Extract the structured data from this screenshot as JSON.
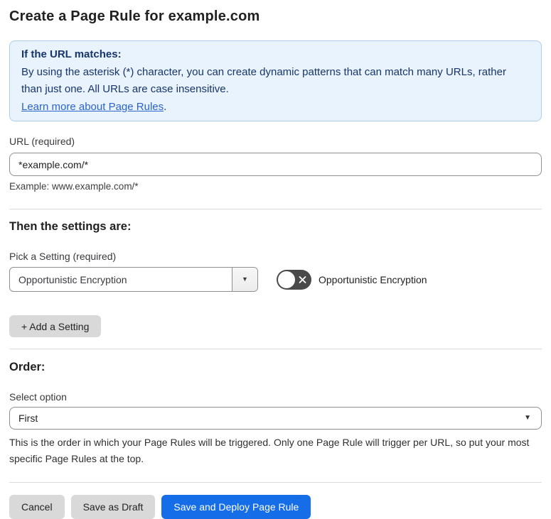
{
  "page": {
    "title": "Create a Page Rule for example.com"
  },
  "info_box": {
    "heading": "If the URL matches:",
    "body": "By using the asterisk (*) character, you can create dynamic patterns that can match many URLs, rather than just one. All URLs are case insensitive.",
    "link_label": "Learn more about Page Rules",
    "link_suffix": "."
  },
  "url_field": {
    "label": "URL (required)",
    "value": "*example.com/*",
    "helper": "Example: www.example.com/*"
  },
  "settings_section": {
    "heading": "Then the settings are:",
    "picker_label": "Pick a Setting (required)",
    "picker_value": "Opportunistic Encryption",
    "toggle_state": "off",
    "toggle_label": "Opportunistic Encryption",
    "add_setting_label": "+ Add a Setting"
  },
  "order_section": {
    "heading": "Order:",
    "select_label": "Select option",
    "select_value": "First",
    "helper": "This is the order in which your Page Rules will be triggered. Only one Page Rule will trigger per URL, so put your most specific Page Rules at the top."
  },
  "actions": {
    "cancel_label": "Cancel",
    "save_draft_label": "Save as Draft",
    "save_deploy_label": "Save and Deploy Page Rule"
  },
  "colors": {
    "accent_blue": "#156de8",
    "info_bg": "#e9f3fd",
    "info_border": "#abcdee",
    "info_text": "#17356b",
    "link_blue": "#2a63cc",
    "toggle_off_bg": "#4a4a4a",
    "button_gray": "#d9d9d9"
  }
}
